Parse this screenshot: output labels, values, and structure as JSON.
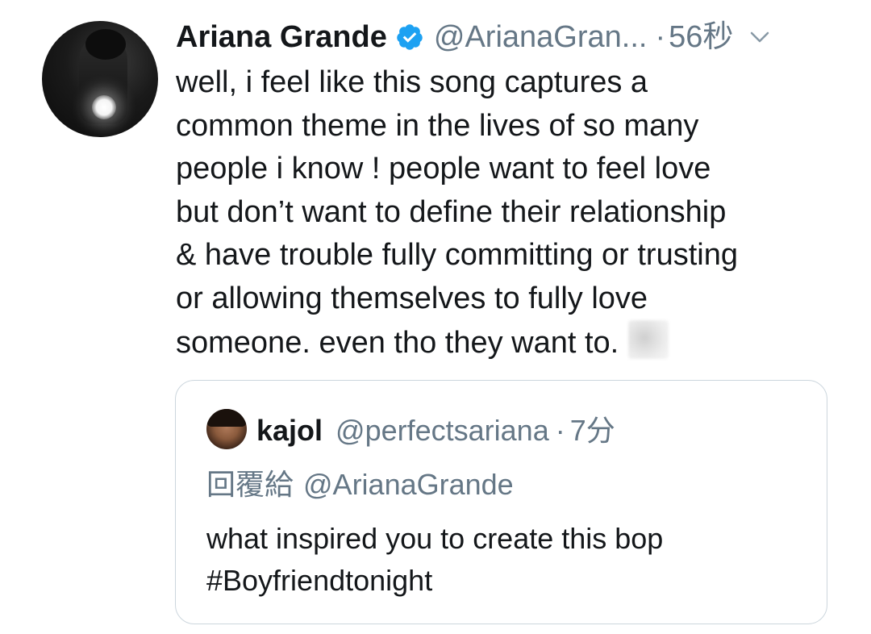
{
  "tweet": {
    "author_name": "Ariana Grande",
    "verified": true,
    "handle": "@ArianaGran...",
    "separator": "·",
    "time": "56秒",
    "body_lines": [
      "well, i feel like this song captures a",
      "common theme in the lives of so many",
      "people i know ! people want to feel love",
      "but don’t want to define their relationship",
      "& have trouble fully committing or trusting",
      "or allowing themselves to fully love",
      "someone. even tho they want to."
    ],
    "trailing_icon": "blurred-emoji",
    "menu_icon": "chevron-down-icon"
  },
  "quote": {
    "author_name": "kajol",
    "handle": "@perfectsariana",
    "separator": "·",
    "time": "7分",
    "reply_prefix": "回覆給",
    "reply_to": "@ArianaGrande",
    "body_lines": [
      "what inspired you to create this bop",
      "#Boyfriendtonight"
    ]
  },
  "colors": {
    "text_primary": "#14171a",
    "text_secondary": "#657786",
    "verified_blue": "#1da1f2",
    "card_border": "#ccd6dd"
  }
}
